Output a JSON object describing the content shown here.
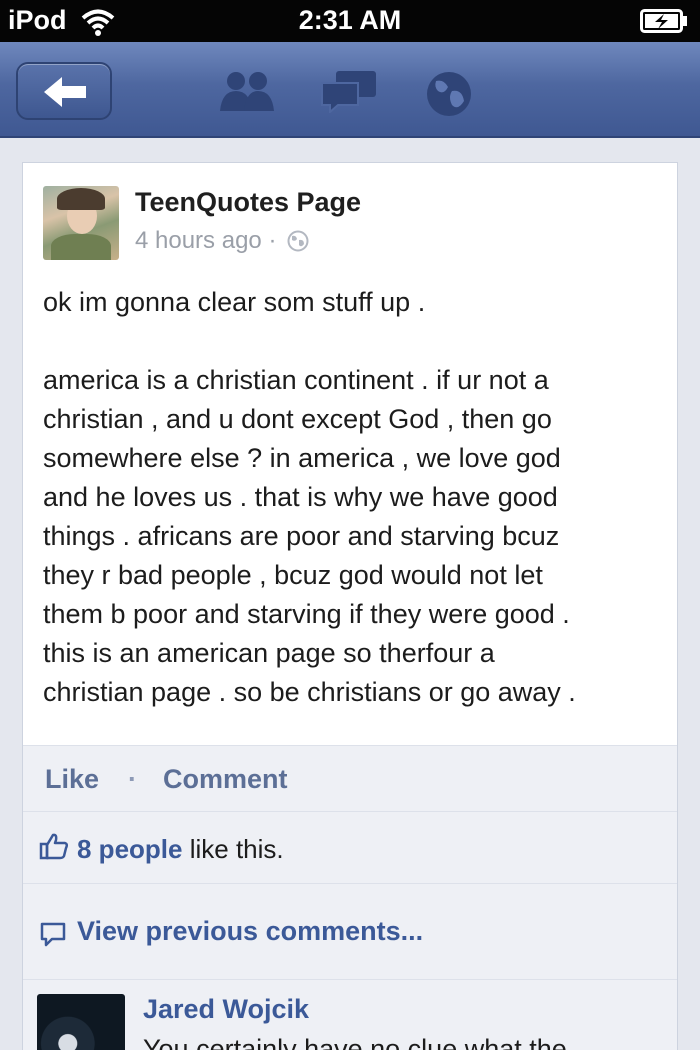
{
  "status_bar": {
    "carrier": "iPod",
    "time": "2:31 AM"
  },
  "nav": {
    "icons": [
      "back-arrow-icon",
      "friends-icon",
      "messages-icon",
      "globe-icon"
    ]
  },
  "post": {
    "author": "TeenQuotes Page",
    "timestamp": "4 hours ago",
    "separator": "·",
    "privacy_icon": "public-globe-icon",
    "text_lines": [
      "ok im gonna clear som stuff up .",
      "",
      "america is a christian continent . if ur not a",
      "christian , and u dont except God , then go",
      "somewhere else ? in america , we love god",
      "and he loves us . that is why we have good",
      "things . africans are poor and starving bcuz",
      "they r bad people , bcuz god would not let",
      "them b poor and starving if they were good .",
      "this is an american page so therfour a",
      "christian page . so be christians or go away ."
    ]
  },
  "actions": {
    "like": "Like",
    "dot": "·",
    "comment": "Comment"
  },
  "likes": {
    "count_text": "8 people",
    "suffix": " like this."
  },
  "view_previous": "View previous comments...",
  "comment": {
    "author": "Jared Wojcik",
    "text": "You certainly have no clue what the"
  },
  "colors": {
    "fb_blue": "#3b5998",
    "nav_bar": "#4e67a0",
    "background": "#e4e7ee"
  }
}
